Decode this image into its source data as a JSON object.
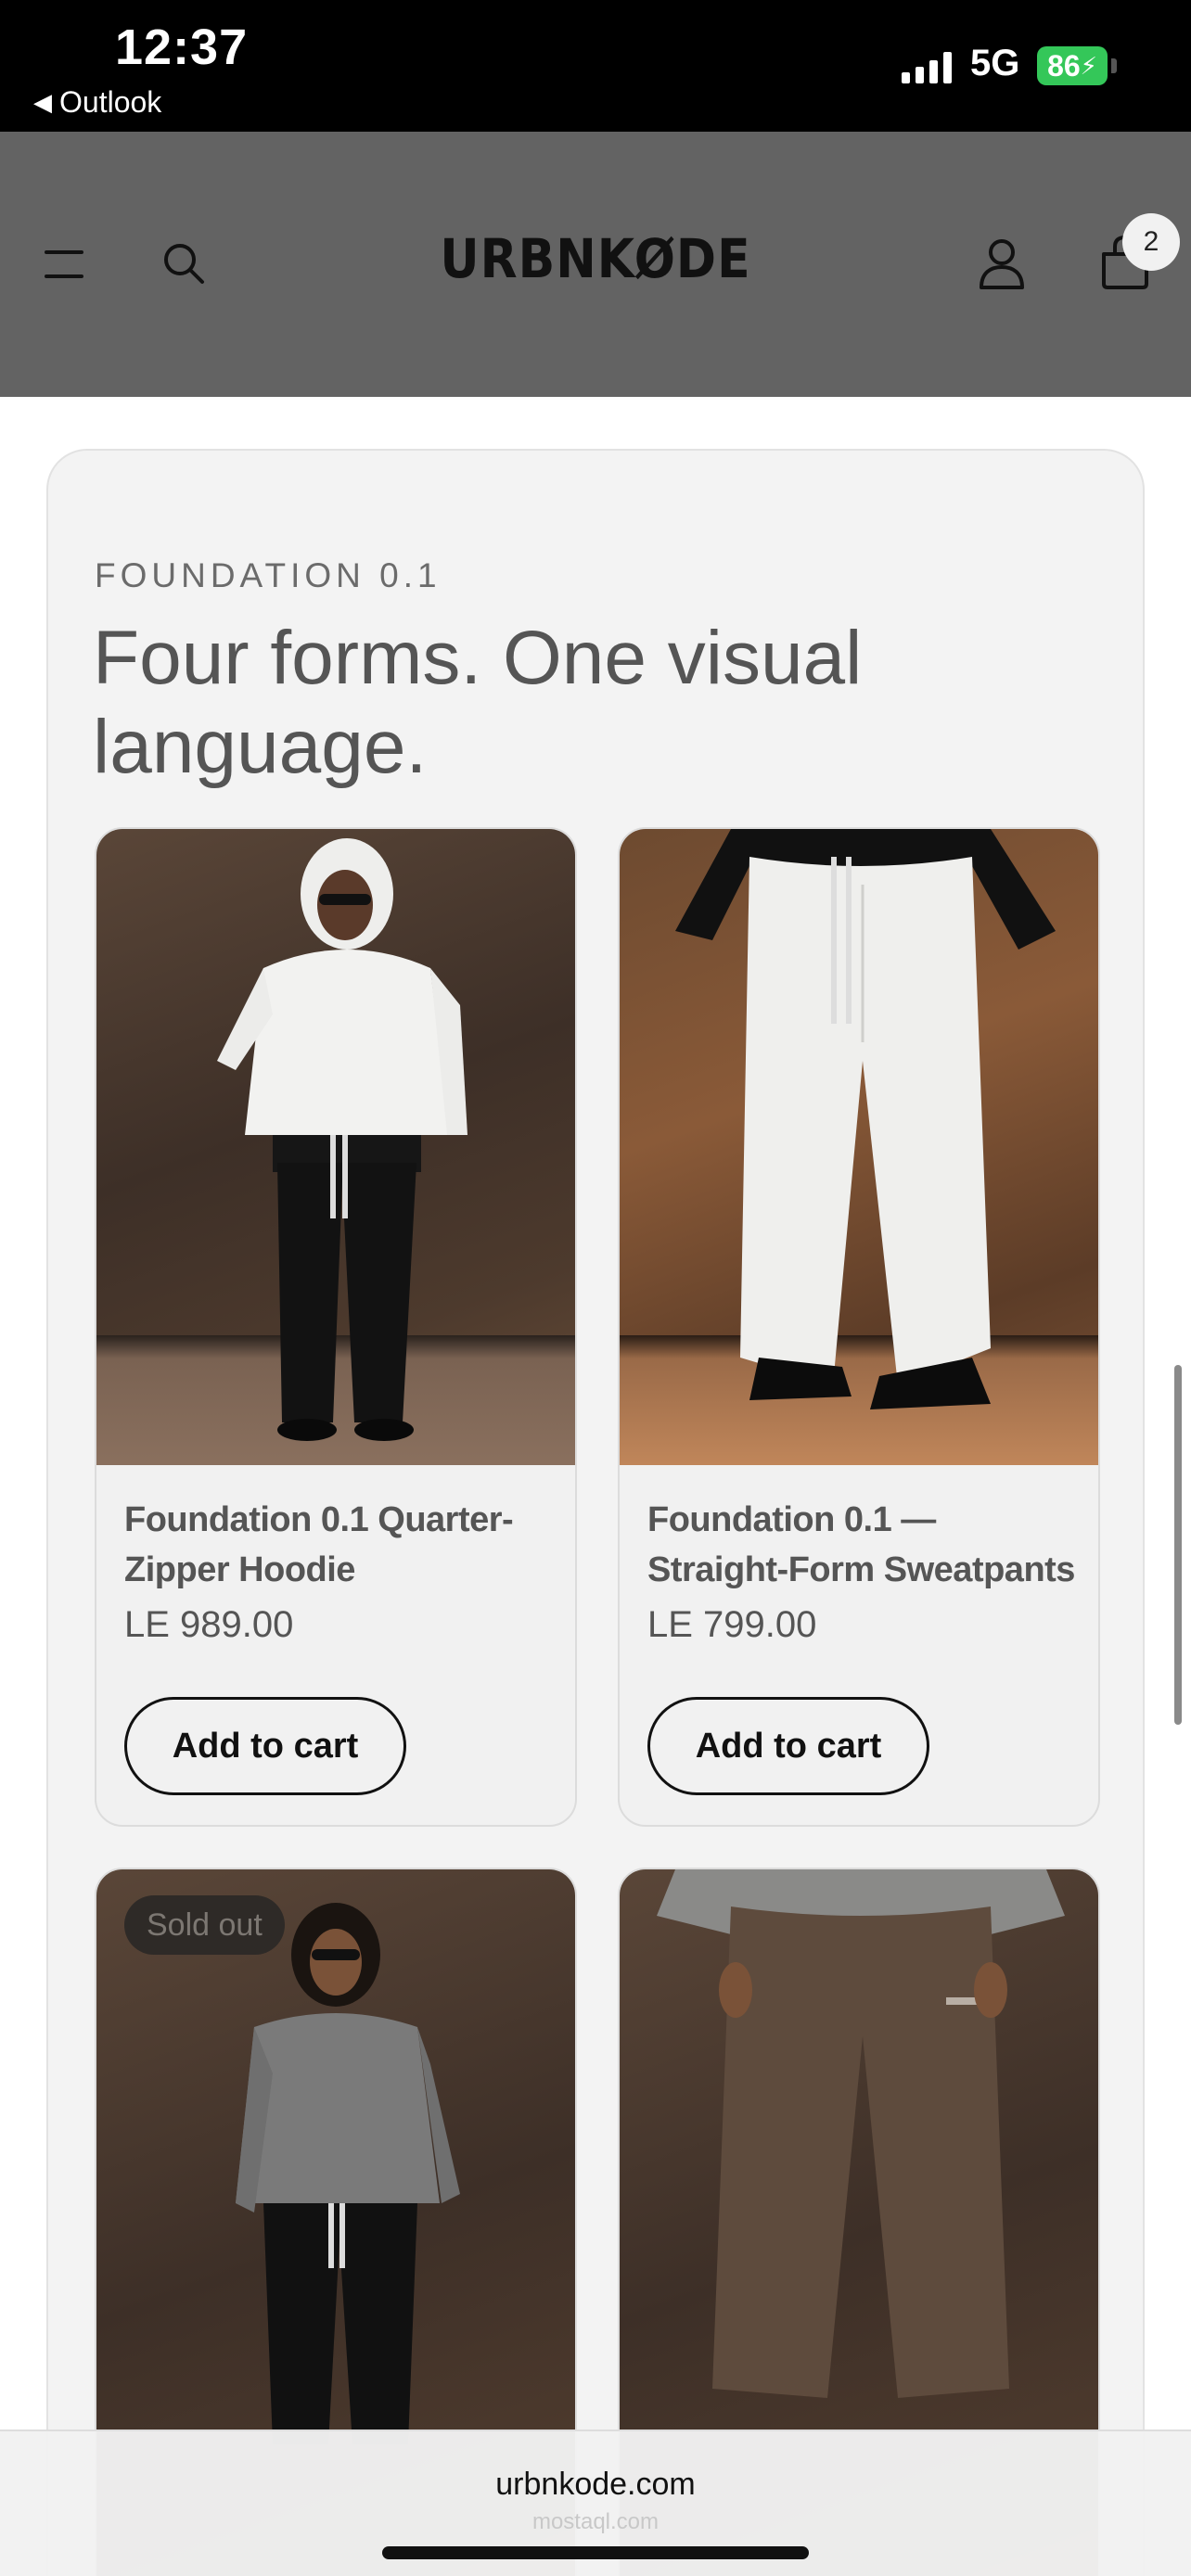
{
  "status_bar": {
    "time": "12:37",
    "back_app": "Outlook",
    "network": "5G",
    "battery": "86"
  },
  "header": {
    "logo": "URBNKØDE",
    "cart_count": "2",
    "background": "#636363"
  },
  "collection": {
    "eyebrow": "FOUNDATION 0.1",
    "headline": "Four forms. One visual language.",
    "products": [
      {
        "name": "Foundation 0.1 Quarter-Zipper Hoodie",
        "price": "LE 989.00",
        "button_label": "Add to cart",
        "image_icon": "model-white-hoodie-photo"
      },
      {
        "name": "Foundation 0.1 — Straight-Form Sweatpants",
        "price": "LE 799.00",
        "button_label": "Add to cart",
        "image_icon": "white-sweatpants-photo"
      },
      {
        "badge": "Sold out",
        "image_icon": "model-grey-quarter-zip-photo"
      },
      {
        "image_icon": "brown-sweatpants-photo"
      }
    ]
  },
  "browser": {
    "url": "urbnkode.com",
    "watermark": "mostaql.com"
  }
}
